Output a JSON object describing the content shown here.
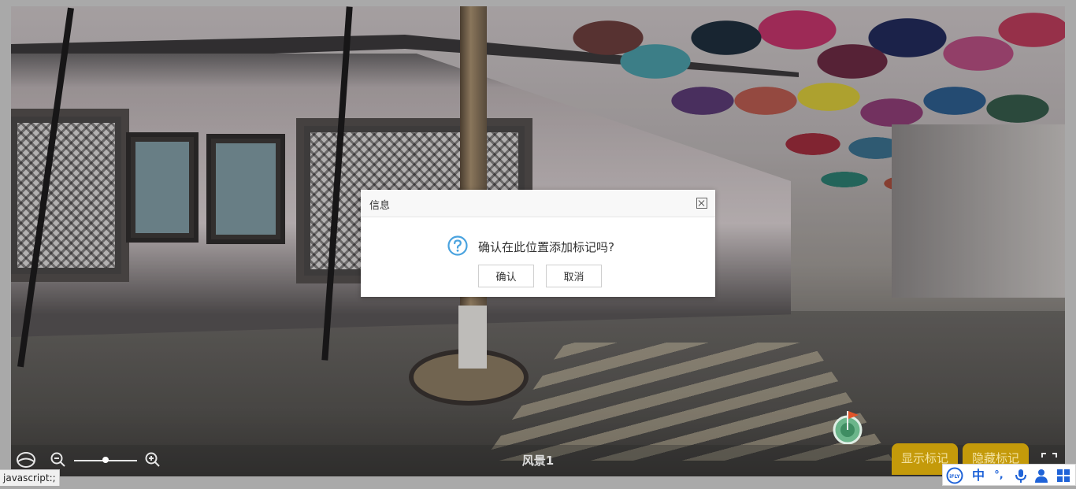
{
  "viewer": {
    "scene_title": "风景1",
    "show_markers_label": "显示标记",
    "hide_markers_label": "隐藏标记",
    "zoom_level_fraction": 0.5
  },
  "dialog": {
    "title": "信息",
    "message": "确认在此位置添加标记吗?",
    "confirm_label": "确认",
    "cancel_label": "取消"
  },
  "status_bar": {
    "url": "javascript:;"
  },
  "ime": {
    "brand": "iFLY",
    "mode_label": "中",
    "punct_label": "°,"
  },
  "colors": {
    "accent": "#c49a0a",
    "question_icon": "#4aa3df",
    "ime_blue": "#1f63d8"
  },
  "icons": [
    "view-mode-icon",
    "zoom-out-icon",
    "zoom-in-icon",
    "fullscreen-icon",
    "flag-marker-icon",
    "question-icon",
    "close-icon",
    "ifly-logo-icon",
    "microphone-icon",
    "user-icon",
    "grid-icon"
  ]
}
